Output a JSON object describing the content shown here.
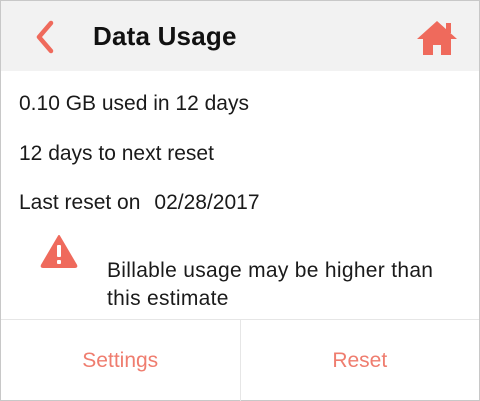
{
  "header": {
    "title": "Data Usage",
    "back_icon": "chevron-left-icon",
    "home_icon": "home-icon",
    "accent_color": "#ef6a5c"
  },
  "usage": {
    "used_text": "0.10 GB used in 12 days",
    "next_reset_text": "12 days to next reset",
    "last_reset_label": "Last reset on",
    "last_reset_date": "02/28/2017"
  },
  "warning": {
    "icon": "warning-icon",
    "text": "Billable usage may be higher than this estimate"
  },
  "footer": {
    "settings_label": "Settings",
    "reset_label": "Reset"
  }
}
